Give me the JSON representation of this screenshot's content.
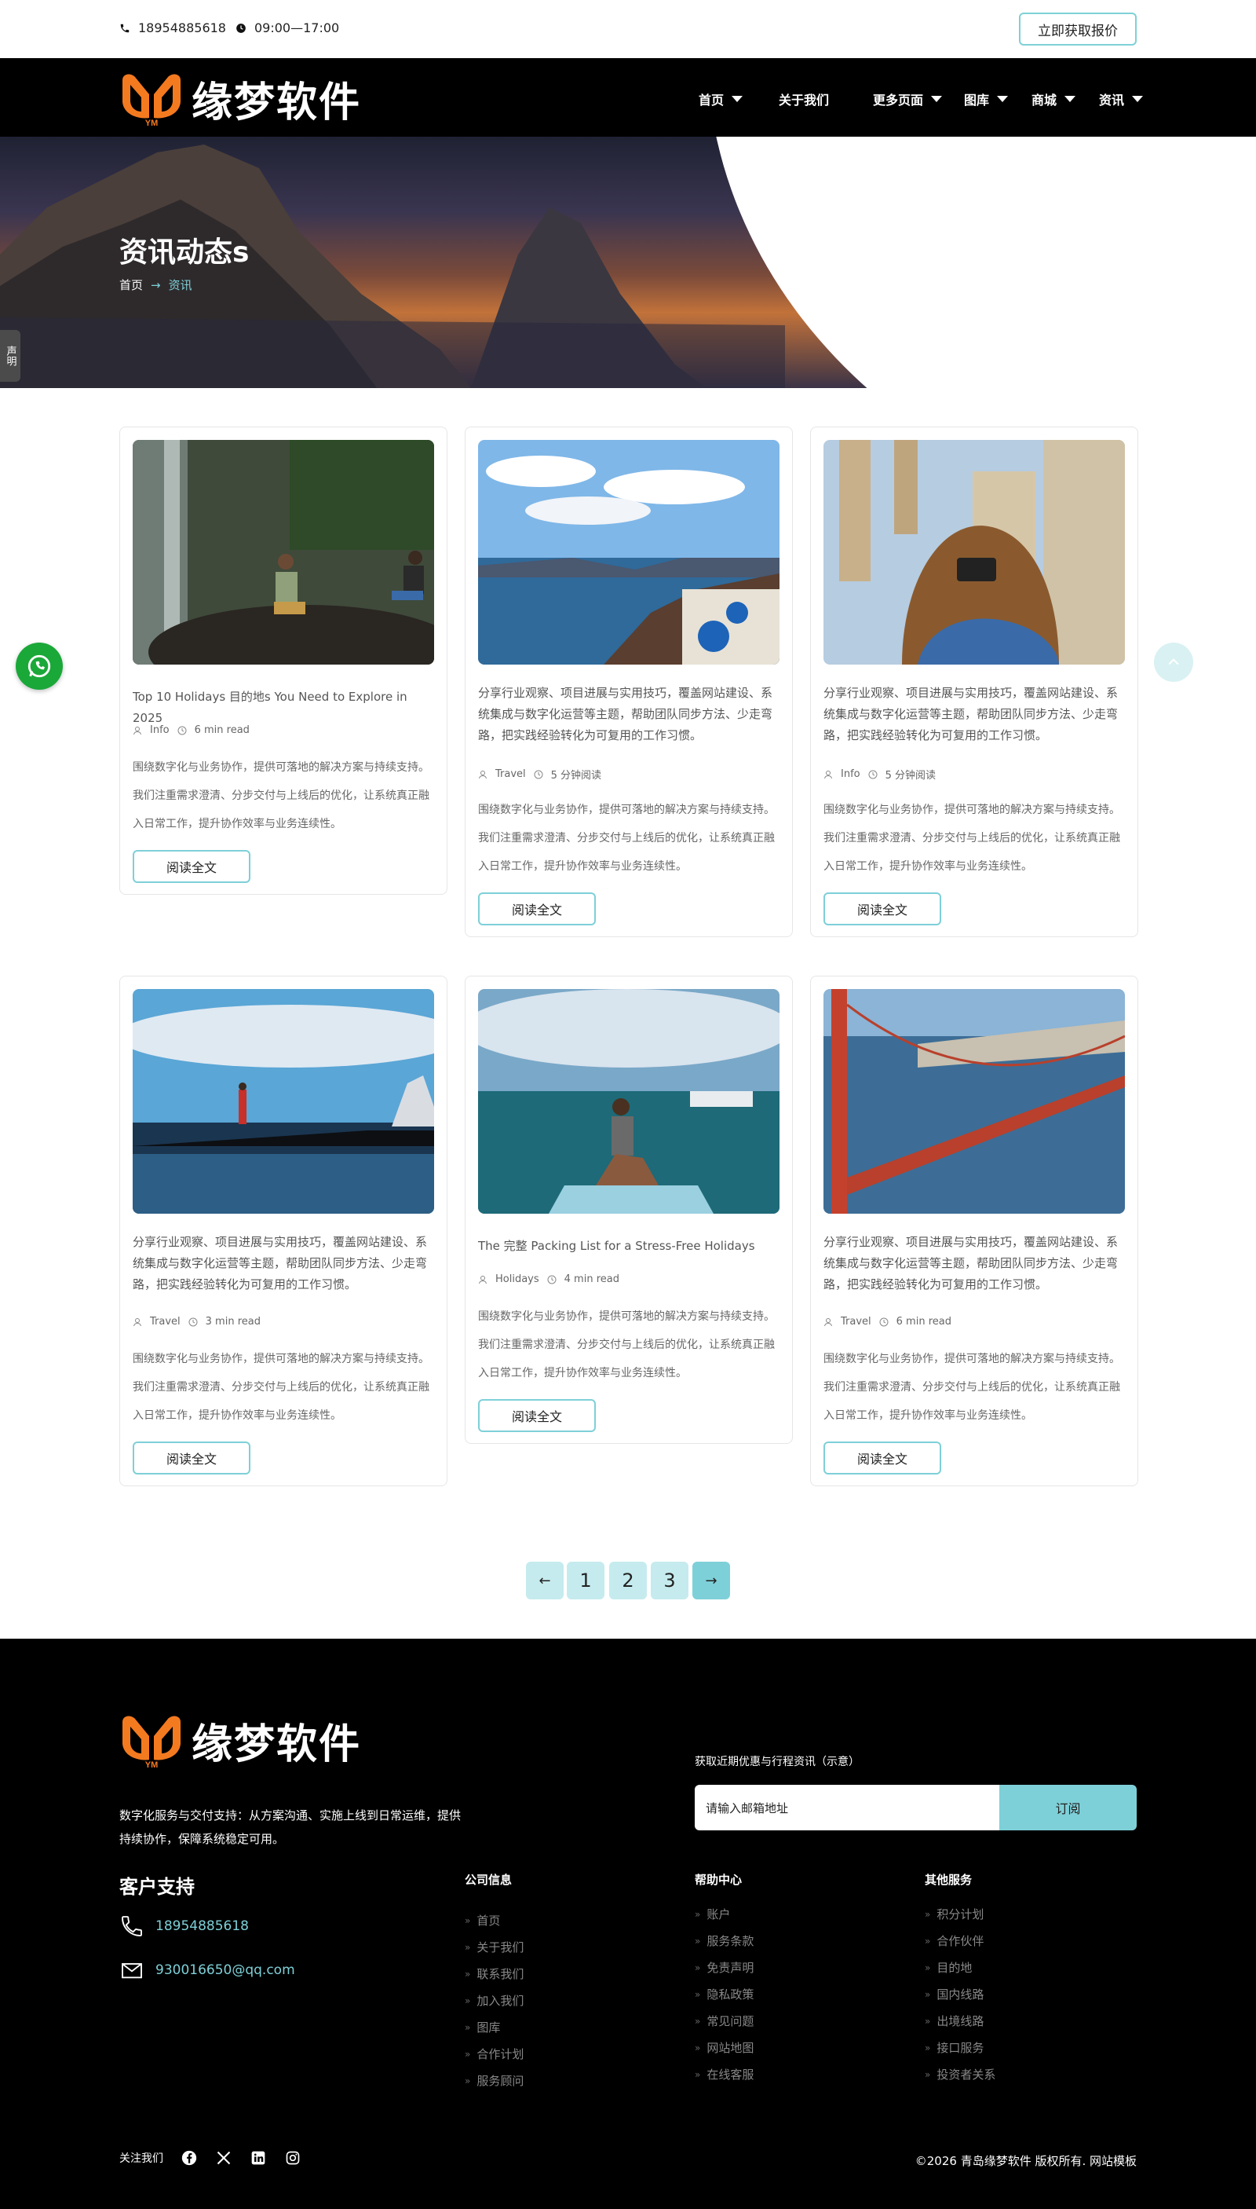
{
  "topbar": {
    "phone": "18954885618",
    "hours": "09:00—17:00",
    "quote_button": "立即获取报价"
  },
  "brand": {
    "name": "缘梦软件",
    "mark_text": "YM",
    "colors": {
      "logo_orange": "#f47a20",
      "accent": "#7ed0d8",
      "nav_bg": "#000000"
    }
  },
  "nav": {
    "items": [
      {
        "label": "首页",
        "dropdown": true
      },
      {
        "label": "关于我们",
        "dropdown": false
      },
      {
        "label": "更多页面",
        "dropdown": true
      },
      {
        "label": "图库",
        "dropdown": true
      },
      {
        "label": "商城",
        "dropdown": true
      },
      {
        "label": "资讯",
        "dropdown": true
      }
    ]
  },
  "hero": {
    "title": "资讯动态s",
    "breadcrumb_home": "首页",
    "breadcrumb_current": "资讯"
  },
  "side_tag": "声明",
  "posts": [
    {
      "title": "Top 10 Holidays 目的地s You Need to Explore in 2025",
      "category": "Info",
      "read_time": "6 min read",
      "excerpt": "围绕数字化与业务协作，提供可落地的解决方案与持续支持。我们注重需求澄清、分步交付与上线后的优化，让系统真正融入日常工作，提升协作效率与业务连续性。",
      "button": "阅读全文",
      "image": "waterfall-couple"
    },
    {
      "title": "分享行业观察、项目进展与实用技巧，覆盖网站建设、系统集成与数字化运营等主题，帮助团队同步方法、少走弯路，把实践经验转化为可复用的工作习惯。",
      "category": "Travel",
      "read_time": "5 分钟阅读",
      "excerpt": "围绕数字化与业务协作，提供可落地的解决方案与持续支持。我们注重需求澄清、分步交付与上线后的优化，让系统真正融入日常工作，提升协作效率与业务连续性。",
      "button": "阅读全文",
      "image": "santorini"
    },
    {
      "title": "分享行业观察、项目进展与实用技巧，覆盖网站建设、系统集成与数字化运营等主题，帮助团队同步方法、少走弯路，把实践经验转化为可复用的工作习惯。",
      "category": "Info",
      "read_time": "5 分钟阅读",
      "excerpt": "围绕数字化与业务协作，提供可落地的解决方案与持续支持。我们注重需求澄清、分步交付与上线后的优化，让系统真正融入日常工作，提升协作效率与业务连续性。",
      "button": "阅读全文",
      "image": "photographer-ruins"
    },
    {
      "title": "分享行业观察、项目进展与实用技巧，覆盖网站建设、系统集成与数字化运营等主题，帮助团队同步方法、少走弯路，把实践经验转化为可复用的工作习惯。",
      "category": "Travel",
      "read_time": "3 min read",
      "excerpt": "围绕数字化与业务协作，提供可落地的解决方案与持续支持。我们注重需求澄清、分步交付与上线后的优化，让系统真正融入日常工作，提升协作效率与业务连续性。",
      "button": "阅读全文",
      "image": "sea-reflection"
    },
    {
      "title": "The 完整 Packing List for a Stress-Free Holidays",
      "category": "Holidays",
      "read_time": "4 min read",
      "excerpt": "围绕数字化与业务协作，提供可落地的解决方案与持续支持。我们注重需求澄清、分步交付与上线后的优化，让系统真正融入日常工作，提升协作效率与业务连续性。",
      "button": "阅读全文",
      "image": "paddleboard"
    },
    {
      "title": "分享行业观察、项目进展与实用技巧，覆盖网站建设、系统集成与数字化运营等主题，帮助团队同步方法、少走弯路，把实践经验转化为可复用的工作习惯。",
      "category": "Travel",
      "read_time": "6 min read",
      "excerpt": "围绕数字化与业务协作，提供可落地的解决方案与持续支持。我们注重需求澄清、分步交付与上线后的优化，让系统真正融入日常工作，提升协作效率与业务连续性。",
      "button": "阅读全文",
      "image": "golden-gate"
    }
  ],
  "pagination": {
    "prev": "←",
    "pages": [
      "1",
      "2",
      "3"
    ],
    "next": "→"
  },
  "footer": {
    "description": "数字化服务与交付支持：从方案沟通、实施上线到日常运维，提供持续协作，保障系统稳定可用。",
    "subscribe_title": "获取近期优惠与行程资讯（示意）",
    "subscribe_placeholder": "请输入邮箱地址",
    "subscribe_button": "订阅",
    "support_title": "客户支持",
    "support_phone": "18954885618",
    "support_email": "930016650@qq.com",
    "columns": [
      {
        "title": "公司信息",
        "links": [
          "首页",
          "关于我们",
          "联系我们",
          "加入我们",
          "图库",
          "合作计划",
          "服务顾问"
        ]
      },
      {
        "title": "帮助中心",
        "links": [
          "账户",
          "服务条款",
          "免责声明",
          "隐私政策",
          "常见问题",
          "网站地图",
          "在线客服"
        ]
      },
      {
        "title": "其他服务",
        "links": [
          "积分计划",
          "合作伙伴",
          "目的地",
          "国内线路",
          "出境线路",
          "接口服务",
          "投资者关系"
        ]
      }
    ],
    "follow_label": "关注我们",
    "social_icons": [
      "facebook-icon",
      "x-icon",
      "linkedin-icon",
      "instagram-icon"
    ],
    "copyright": "©2026 青岛缘梦软件 版权所有. 网站模板"
  }
}
